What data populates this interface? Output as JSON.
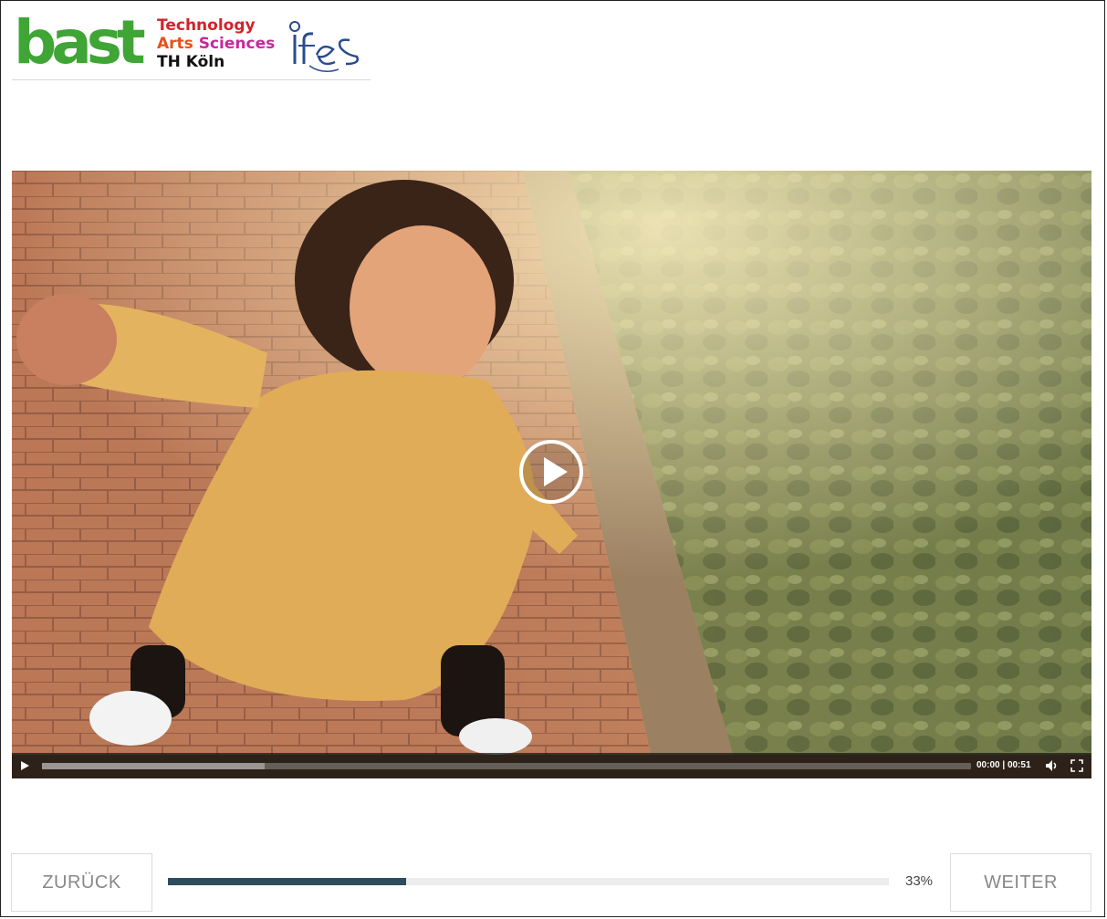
{
  "logos": {
    "bast": "bast",
    "th_line1": "Technology",
    "th_line2_a": "Arts",
    "th_line2_b": " Sciences",
    "th_line3": "TH Köln",
    "ifes": "ifes"
  },
  "video": {
    "time_current": "00:00",
    "time_separator": " | ",
    "time_total": "00:51",
    "buffered_fraction": 0.24
  },
  "navigation": {
    "back_label": "ZURÜCK",
    "next_label": "WEITER",
    "progress_label": "33%",
    "progress_fraction": 0.33
  },
  "colors": {
    "bast_green": "#3fa535",
    "progress_fill": "#2b4d5c",
    "th_red": "#d2232a"
  }
}
